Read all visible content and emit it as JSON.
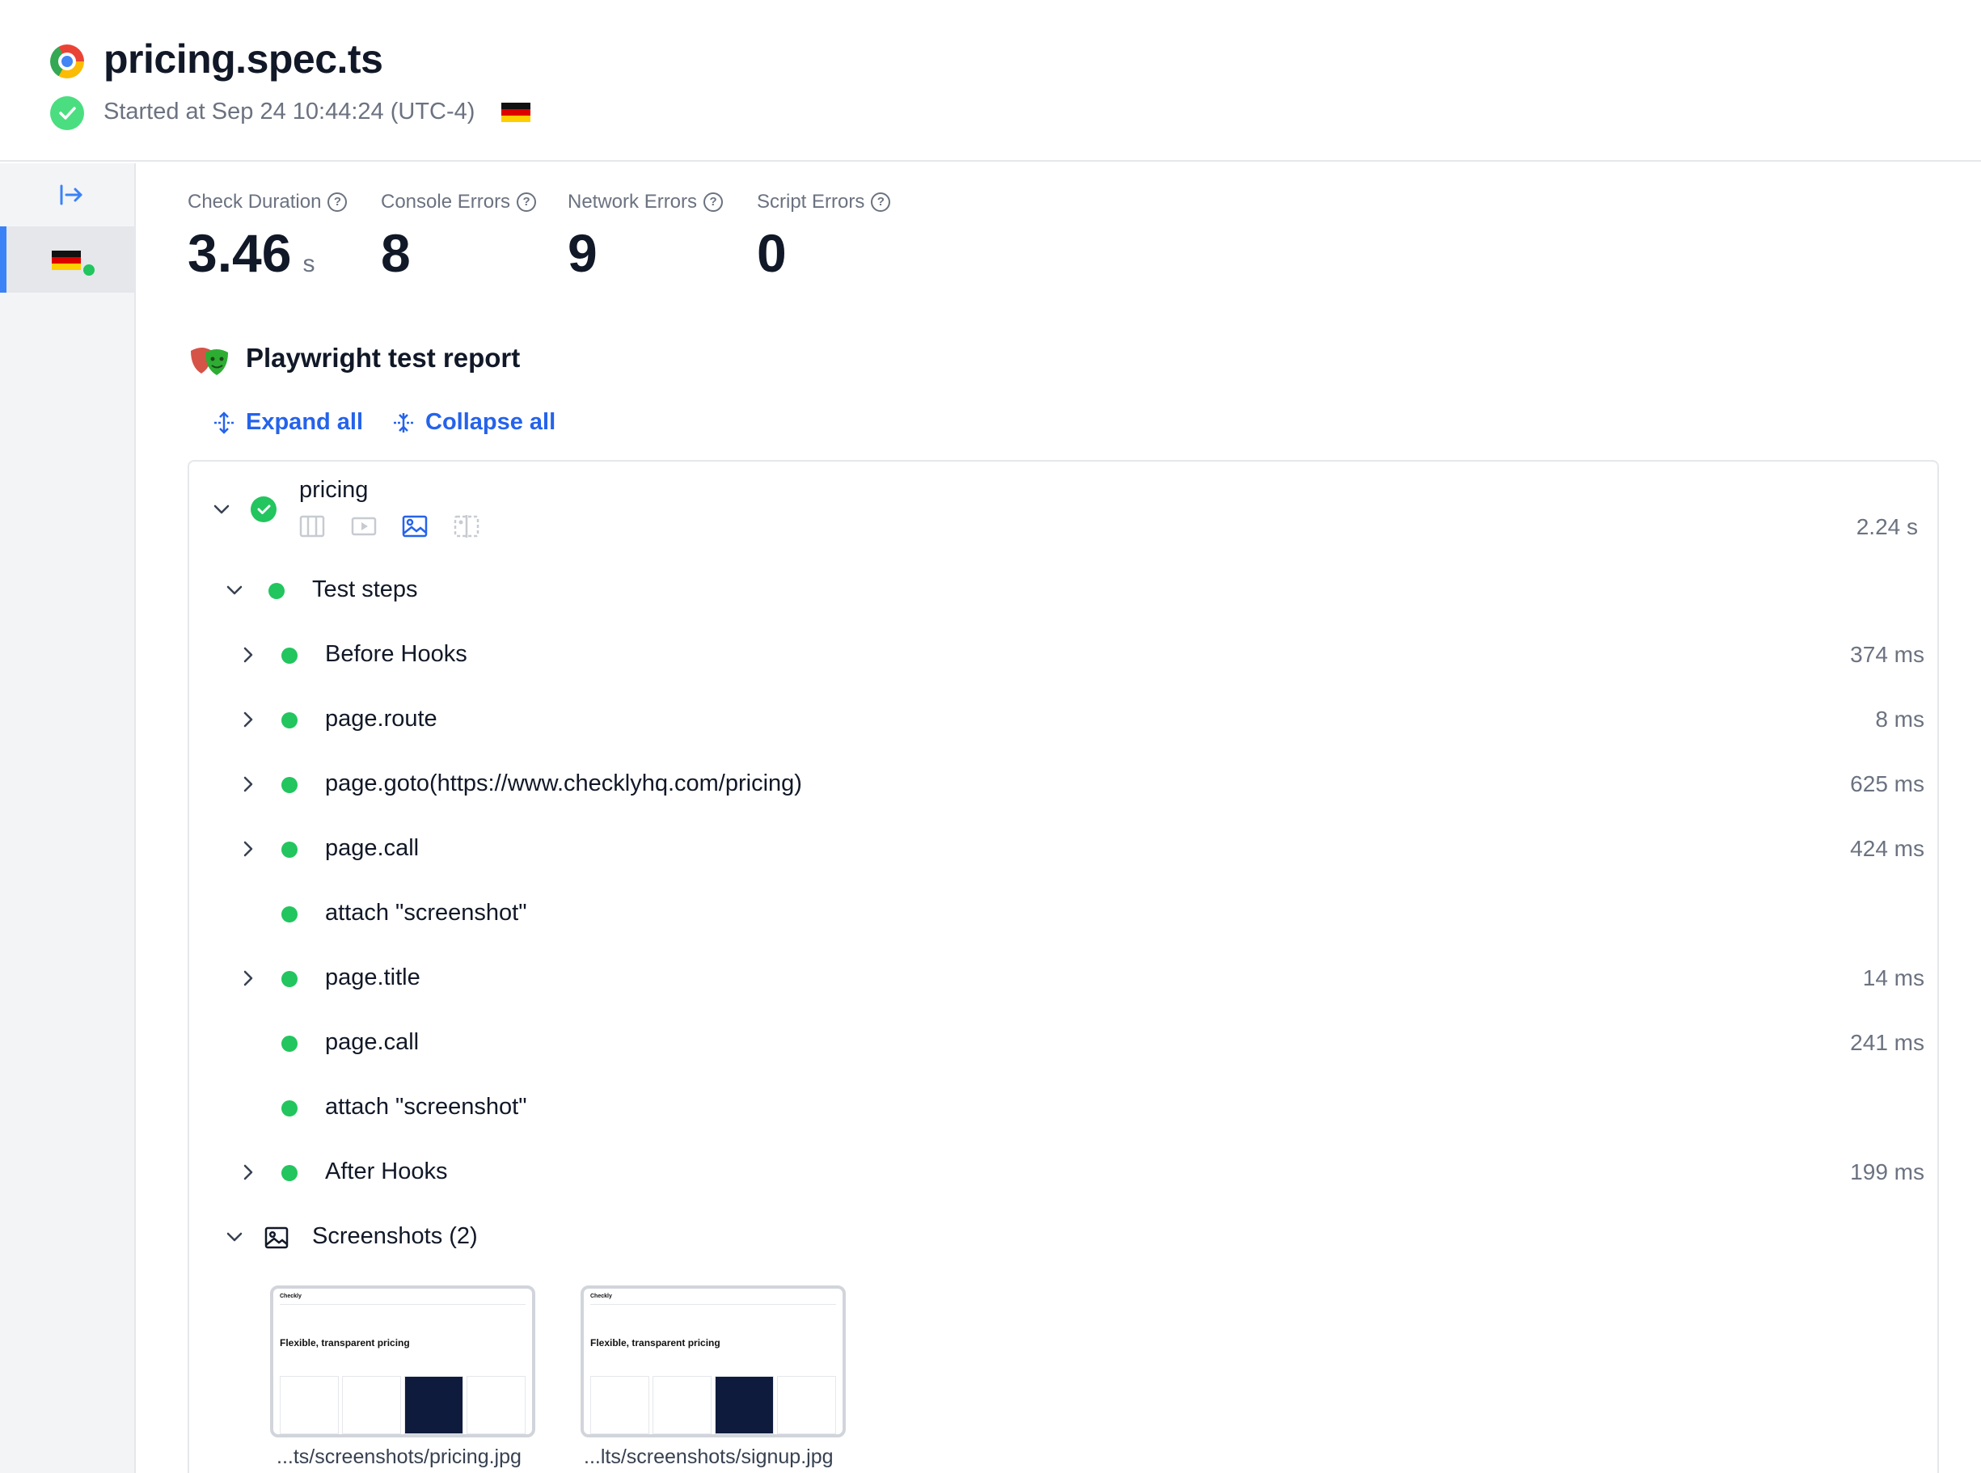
{
  "header": {
    "title": "pricing.spec.ts",
    "started": "Started at Sep 24 10:44:24 (UTC-4)"
  },
  "metrics": [
    {
      "label": "Check Duration",
      "value": "3.46",
      "unit": "s"
    },
    {
      "label": "Console Errors",
      "value": "8",
      "unit": ""
    },
    {
      "label": "Network Errors",
      "value": "9",
      "unit": ""
    },
    {
      "label": "Script Errors",
      "value": "0",
      "unit": ""
    }
  ],
  "report": {
    "title": "Playwright test report",
    "expand_all": "Expand all",
    "collapse_all": "Collapse all",
    "test_name": "pricing",
    "test_duration": "2.24 s",
    "test_steps_label": "Test steps",
    "steps": [
      {
        "label": "Before Hooks",
        "duration": "374 ms",
        "expandable": true
      },
      {
        "label": "page.route",
        "duration": "8 ms",
        "expandable": true
      },
      {
        "label": "page.goto(https://www.checklyhq.com/pricing)",
        "duration": "625 ms",
        "expandable": true
      },
      {
        "label": "page.call",
        "duration": "424 ms",
        "expandable": true
      },
      {
        "label": "attach \"screenshot\"",
        "duration": "",
        "expandable": false
      },
      {
        "label": "page.title",
        "duration": "14 ms",
        "expandable": true
      },
      {
        "label": "page.call",
        "duration": "241 ms",
        "expandable": false
      },
      {
        "label": "attach \"screenshot\"",
        "duration": "",
        "expandable": false
      },
      {
        "label": "After Hooks",
        "duration": "199 ms",
        "expandable": true
      }
    ],
    "screenshots_label": "Screenshots (2)",
    "screenshots": [
      {
        "name": "...ts/screenshots/pricing.jpg",
        "heading": "Flexible, transparent pricing"
      },
      {
        "name": "...lts/screenshots/signup.jpg",
        "heading": "Flexible, transparent pricing"
      }
    ]
  },
  "colors": {
    "accent": "#2563eb",
    "success": "#22c55e",
    "sidebar_active": "#3b82f6"
  }
}
